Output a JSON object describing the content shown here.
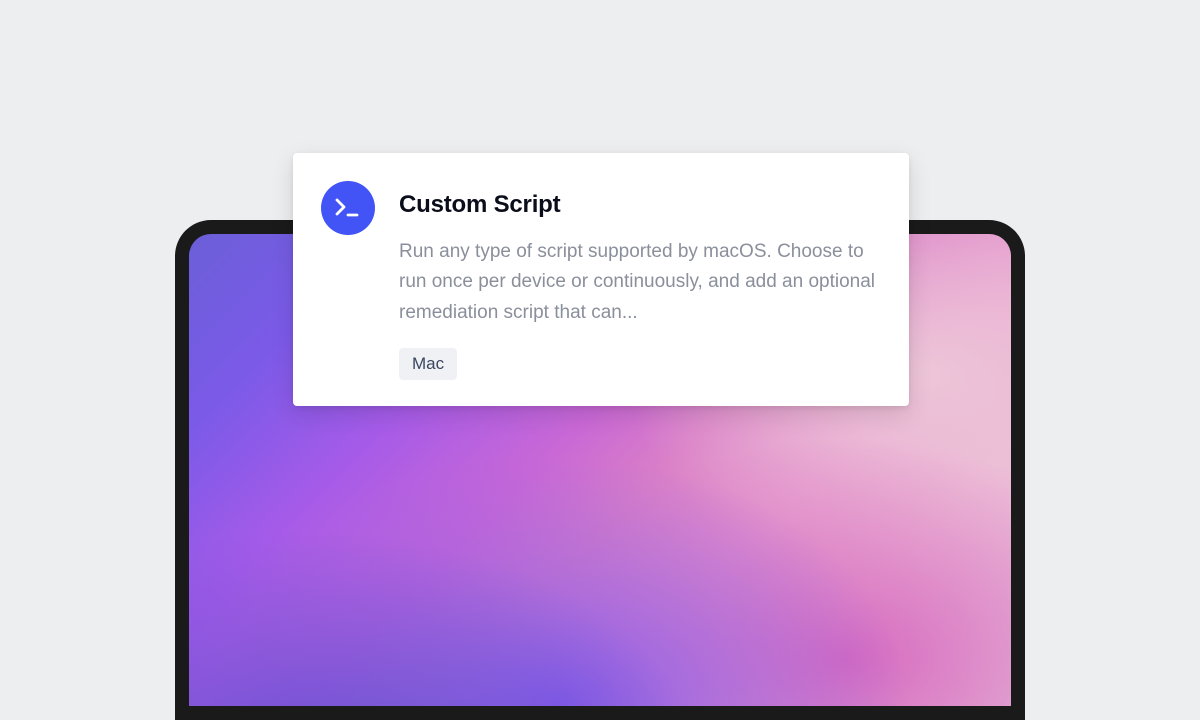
{
  "card": {
    "title": "Custom Script",
    "description": "Run any type of script supported by macOS. Choose to run once per device or continuously, and add an optional remediation script that can...",
    "badge": "Mac",
    "icon": "terminal-icon"
  }
}
